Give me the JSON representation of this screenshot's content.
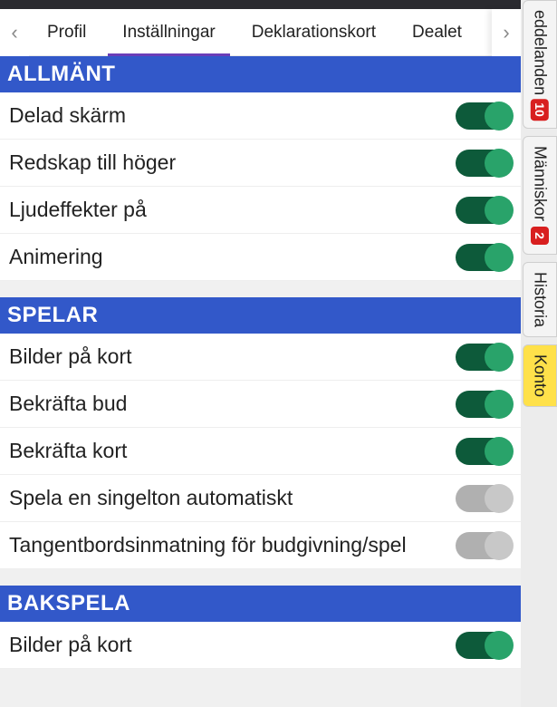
{
  "tabs": {
    "items": [
      "Profil",
      "Inställningar",
      "Deklarationskort",
      "Dealet"
    ],
    "activeIndex": 1
  },
  "settings": {
    "sections": [
      {
        "title": "ALLMÄNT",
        "rows": [
          {
            "label": "Delad skärm",
            "on": true
          },
          {
            "label": "Redskap till höger",
            "on": true
          },
          {
            "label": "Ljudeffekter på",
            "on": true
          },
          {
            "label": "Animering",
            "on": true
          }
        ]
      },
      {
        "title": "SPELAR",
        "rows": [
          {
            "label": "Bilder på kort",
            "on": true
          },
          {
            "label": "Bekräfta bud",
            "on": true
          },
          {
            "label": "Bekräfta kort",
            "on": true
          },
          {
            "label": "Spela en singelton automatiskt",
            "on": false
          },
          {
            "label": "Tangentbordsinmatning för budgivning/spel",
            "on": false
          }
        ]
      },
      {
        "title": "BAKSPELA",
        "rows": [
          {
            "label": "Bilder på kort",
            "on": true
          }
        ]
      }
    ]
  },
  "side": {
    "items": [
      {
        "label": "eddelanden",
        "badge": "10",
        "active": false
      },
      {
        "label": "Människor",
        "badge": "2",
        "active": false
      },
      {
        "label": "Historia",
        "badge": null,
        "active": false
      },
      {
        "label": "Konto",
        "badge": null,
        "active": true
      }
    ]
  }
}
